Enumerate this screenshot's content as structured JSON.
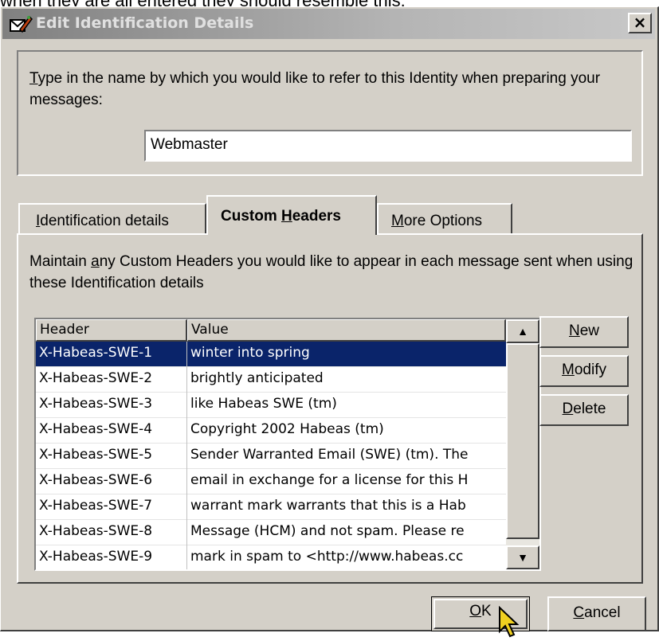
{
  "caption": "when they are all entered they should resemble this:",
  "window": {
    "title": "Edit Identification Details",
    "close_glyph": "×"
  },
  "identity": {
    "prompt_text": "Type in the name by which you would like to refer to this Identity when preparing your messages:",
    "prompt_rest": "ype in the name by which you would like to refer to this Identity when preparing your messages:",
    "name_value": "Webmaster"
  },
  "tabs": [
    {
      "label": "Identification details",
      "selected": false
    },
    {
      "label": "Custom Headers",
      "selected": true
    },
    {
      "label": "More Options",
      "selected": false
    }
  ],
  "panel": {
    "description": "Maintain any Custom Headers you would like to appear in each message sent when using these Identification details"
  },
  "table": {
    "columns": [
      "Header",
      "Value"
    ],
    "rows": [
      {
        "header": "X-Habeas-SWE-1",
        "value": "winter into spring"
      },
      {
        "header": "X-Habeas-SWE-2",
        "value": "brightly anticipated"
      },
      {
        "header": "X-Habeas-SWE-3",
        "value": "like Habeas SWE (tm)"
      },
      {
        "header": "X-Habeas-SWE-4",
        "value": "Copyright 2002 Habeas (tm)"
      },
      {
        "header": "X-Habeas-SWE-5",
        "value": "Sender Warranted Email (SWE) (tm). The"
      },
      {
        "header": "X-Habeas-SWE-6",
        "value": "email in exchange for a license for this H"
      },
      {
        "header": "X-Habeas-SWE-7",
        "value": "warrant mark warrants that this is a Hab"
      },
      {
        "header": "X-Habeas-SWE-8",
        "value": "Message (HCM) and not spam. Please re"
      },
      {
        "header": "X-Habeas-SWE-9",
        "value": "mark in spam to <http://www.habeas.cc"
      }
    ],
    "selected_index": 0
  },
  "buttons": {
    "new": "New",
    "modify": "Modify",
    "delete": "Delete",
    "ok": "OK",
    "cancel": "Cancel"
  },
  "colors": {
    "selection": "#0a246a",
    "face": "#d4d0c8"
  },
  "icons": [
    "app-icon",
    "close-icon",
    "scroll-up-icon",
    "scroll-down-icon",
    "mouse-pointer-icon"
  ]
}
